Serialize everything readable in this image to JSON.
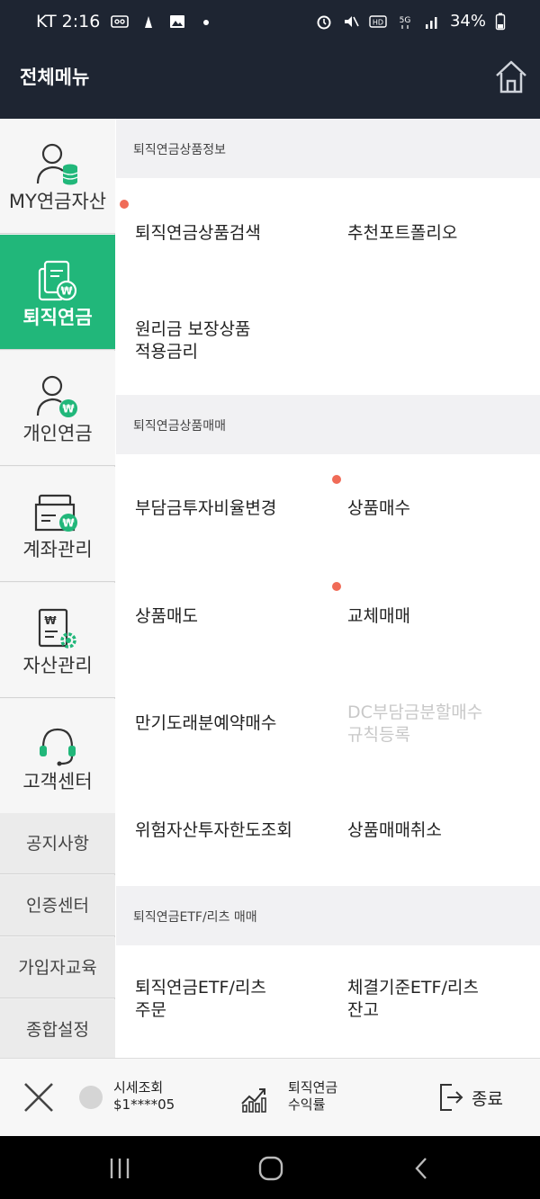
{
  "status": {
    "carrier_time": "KT 2:16",
    "battery": "34%",
    "left_icons": [
      "voicemail-icon",
      "wisdom-icon",
      "image-icon",
      "dot-icon"
    ],
    "right_icons": [
      "alarm-icon",
      "mute-icon",
      "hd-icon",
      "5g-icon",
      "signal-icon"
    ]
  },
  "header": {
    "title": "전체메뉴"
  },
  "sidebar": {
    "main": [
      {
        "label": "MY연금자산",
        "icon": "my-pension-assets-icon",
        "active": false
      },
      {
        "label": "퇴직연금",
        "icon": "retirement-pension-icon",
        "active": true
      },
      {
        "label": "개인연금",
        "icon": "personal-pension-icon",
        "active": false
      },
      {
        "label": "계좌관리",
        "icon": "account-management-icon",
        "active": false
      },
      {
        "label": "자산관리",
        "icon": "asset-management-icon",
        "active": false
      },
      {
        "label": "고객센터",
        "icon": "headset-icon",
        "active": false
      }
    ],
    "secondary": [
      "공지사항",
      "인증센터",
      "가입자교육",
      "종합설정"
    ]
  },
  "sections": [
    {
      "title": "퇴직연금상품정보",
      "items": [
        {
          "label": "퇴직연금상품검색",
          "new_dot": true,
          "disabled": false
        },
        {
          "label": "추천포트폴리오",
          "new_dot": false,
          "disabled": false
        },
        {
          "label": "원리금 보장상품\n적용금리",
          "new_dot": false,
          "disabled": false
        }
      ]
    },
    {
      "title": "퇴직연금상품매매",
      "items": [
        {
          "label": "부담금투자비율변경",
          "new_dot": false,
          "disabled": false
        },
        {
          "label": "상품매수",
          "new_dot": true,
          "disabled": false
        },
        {
          "label": "상품매도",
          "new_dot": false,
          "disabled": false
        },
        {
          "label": "교체매매",
          "new_dot": true,
          "disabled": false
        },
        {
          "label": "만기도래분예약매수",
          "new_dot": false,
          "disabled": false
        },
        {
          "label": "DC부담금분할매수\n규칙등록",
          "new_dot": false,
          "disabled": true
        },
        {
          "label": "위험자산투자한도조회",
          "new_dot": false,
          "disabled": false
        },
        {
          "label": "상품매매취소",
          "new_dot": false,
          "disabled": false
        }
      ]
    },
    {
      "title": "퇴직연금ETF/리츠 매매",
      "items": [
        {
          "label": "퇴직연금ETF/리츠\n주문",
          "new_dot": false,
          "disabled": false
        },
        {
          "label": "체결기준ETF/리츠\n잔고",
          "new_dot": false,
          "disabled": false
        }
      ]
    }
  ],
  "bottombar": {
    "quote_title": "시세조회",
    "quote_code": "$1****05",
    "returns_line1": "퇴직연금",
    "returns_line2": "수익률",
    "exit_label": "종료"
  },
  "colors": {
    "accent": "#21b77a",
    "header_bg": "#1e2532",
    "dot": "#f06b57"
  }
}
